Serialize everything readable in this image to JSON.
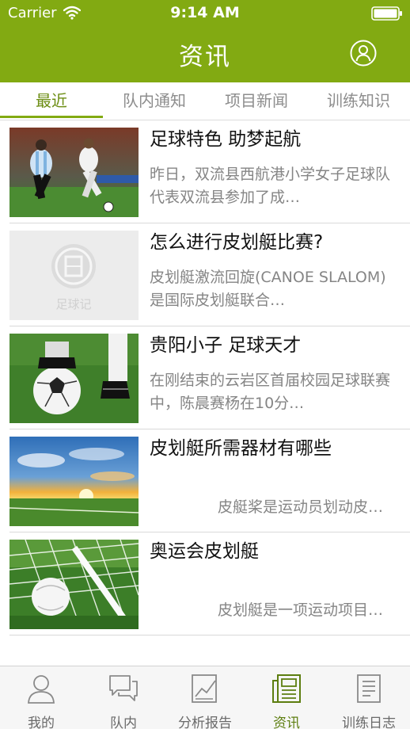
{
  "status": {
    "carrier": "Carrier",
    "time": "9:14 AM"
  },
  "nav": {
    "title": "资讯",
    "profile_icon": "user-circle-icon"
  },
  "tabs": [
    {
      "label": "最近",
      "active": true
    },
    {
      "label": "队内通知",
      "active": false
    },
    {
      "label": "项目新闻",
      "active": false
    },
    {
      "label": "训练知识",
      "active": false
    }
  ],
  "news": [
    {
      "title": "足球特色 助梦起航",
      "summary": "昨日，双流县西航港小学女子足球队代表双流县参加了成…",
      "image": "soccer-players-photo"
    },
    {
      "title": "怎么进行皮划艇比赛?",
      "summary": "皮划艇激流回旋(CANOE SLALOM)是国际皮划艇联合…",
      "image": "placeholder-logo",
      "placeholder_text": "足球记"
    },
    {
      "title": "贵阳小子 足球天才",
      "summary": "在刚结束的云岩区首届校园足球联赛中，陈晨赛杨在10分…",
      "image": "cleat-on-ball-photo"
    },
    {
      "title": "皮划艇所需器材有哪些",
      "summary": "皮艇桨是运动员划动皮…",
      "image": "sunset-field-photo"
    },
    {
      "title": "奥运会皮划艇",
      "summary": "皮划艇是一项运动项目…",
      "image": "ball-in-net-photo"
    }
  ],
  "tabbar": [
    {
      "label": "我的",
      "icon": "person-icon",
      "active": false
    },
    {
      "label": "队内",
      "icon": "chat-bubbles-icon",
      "active": false
    },
    {
      "label": "分析报告",
      "icon": "chart-report-icon",
      "active": false
    },
    {
      "label": "资讯",
      "icon": "newspaper-icon",
      "active": true
    },
    {
      "label": "训练日志",
      "icon": "log-document-icon",
      "active": false
    }
  ],
  "colors": {
    "brand": "#82aa12",
    "active_text": "#5d7e10",
    "inactive_text": "#8d8d8d"
  }
}
